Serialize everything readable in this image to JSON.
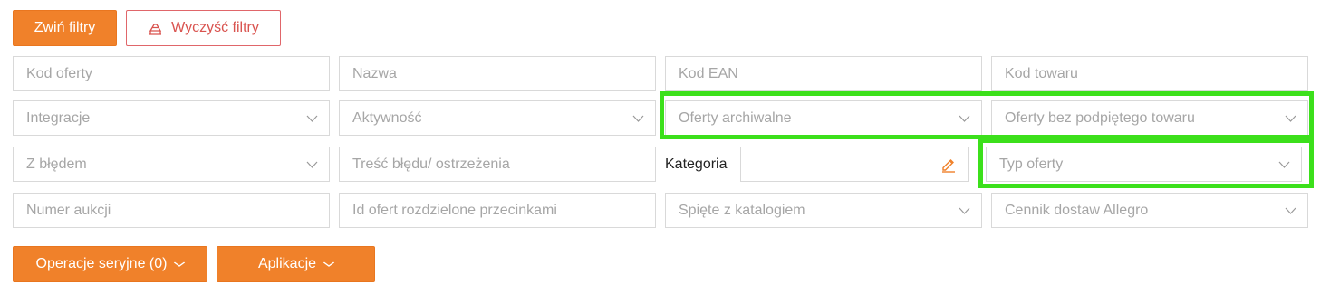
{
  "toolbar": {
    "collapse_label": "Zwiń filtry",
    "clear_label": "Wyczyść filtry"
  },
  "filters": {
    "offer_code_ph": "Kod oferty",
    "name_ph": "Nazwa",
    "ean_ph": "Kod EAN",
    "product_code_ph": "Kod towaru",
    "integrations": "Integracje",
    "activity": "Aktywność",
    "archived": "Oferty archiwalne",
    "no_product": "Oferty bez podpiętego towaru",
    "with_error": "Z błędem",
    "error_text_ph": "Treść błędu/ ostrzeżenia",
    "category_label": "Kategoria",
    "category_value": "",
    "offer_type": "Typ oferty",
    "auction_number_ph": "Numer aukcji",
    "offer_ids_ph": "Id ofert rozdzielone przecinkami",
    "catalog_linked": "Spięte z katalogiem",
    "allegro_pricing": "Cennik dostaw Allegro"
  },
  "actions": {
    "bulk_ops_label": "Operacje seryjne (0)",
    "apps_label": "Aplikacje"
  },
  "colors": {
    "accent": "#f0812a",
    "danger": "#d9534f",
    "highlight": "#3ce01b"
  }
}
